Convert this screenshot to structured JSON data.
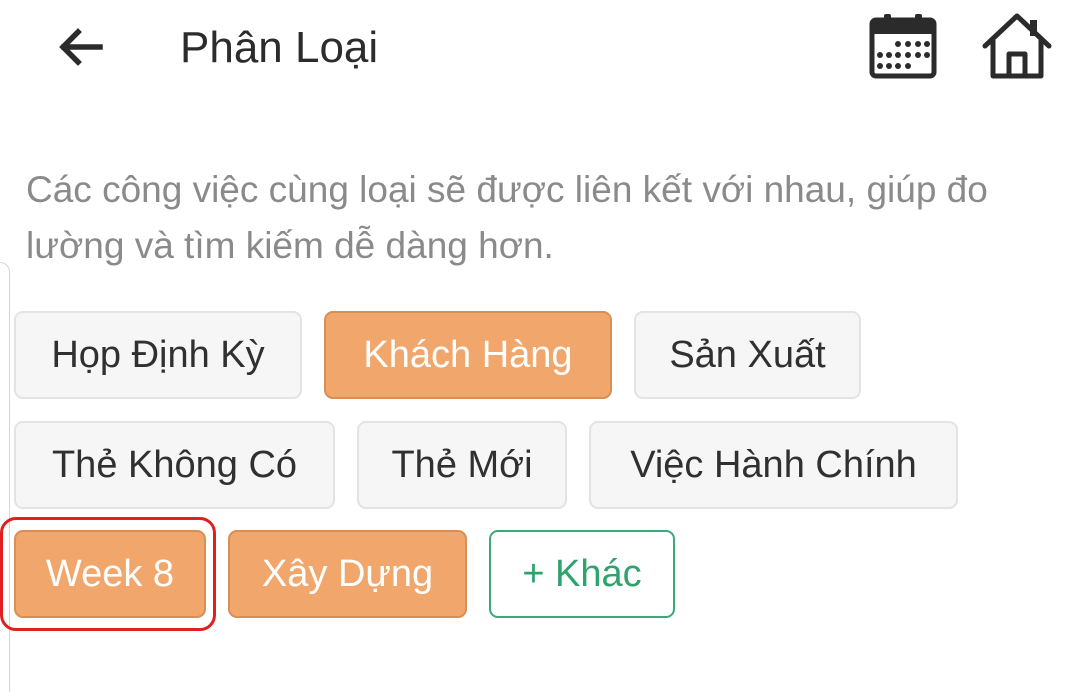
{
  "header": {
    "title": "Phân Loại",
    "back_icon": "arrow-left-icon",
    "calendar_icon": "calendar-icon",
    "home_icon": "home-icon"
  },
  "description": "Các công việc cùng loại sẽ được liên kết với nhau, giúp đo lường và tìm kiếm dễ dàng hơn.",
  "tags": [
    {
      "label": "Họp Định Kỳ",
      "selected": false
    },
    {
      "label": "Khách Hàng",
      "selected": true
    },
    {
      "label": "Sản Xuất",
      "selected": false
    },
    {
      "label": "Thẻ Không Có",
      "selected": false
    },
    {
      "label": "Thẻ Mới",
      "selected": false
    },
    {
      "label": "Việc Hành Chính",
      "selected": false
    },
    {
      "label": "Week 8",
      "selected": true
    },
    {
      "label": "Xây Dựng",
      "selected": true
    }
  ],
  "add_tag_label": "+ Khác",
  "colors": {
    "selected_fill": "#f1a66c",
    "add_accent": "#2ea36e",
    "highlight": "#e02020"
  }
}
